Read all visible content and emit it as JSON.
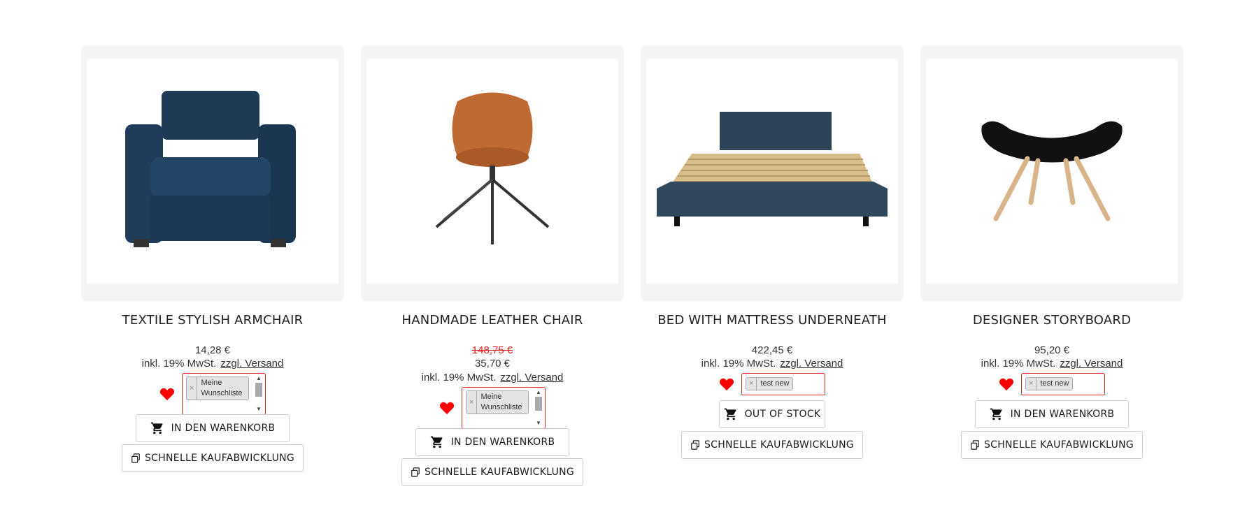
{
  "colors": {
    "accent_red": "#e32626",
    "heart": "#ff0000",
    "strike_price": "#e02020"
  },
  "products": [
    {
      "title": "TEXTILE STYLISH ARMCHAIR",
      "image": "blue-armchair-image",
      "old_price": null,
      "price": "14,28 €",
      "tax": "inkl. 19% MwSt.",
      "shipping": "zzgl. Versand",
      "wishlist_tag": "Meine Wunschliste",
      "cart_label": "IN DEN WARENKORB",
      "quick_label": "SCHNELLE KAUFABWICKLUNG"
    },
    {
      "title": "HANDMADE LEATHER CHAIR",
      "image": "leather-chair-image",
      "old_price": "148,75 €",
      "price": "35,70 €",
      "tax": "inkl. 19% MwSt.",
      "shipping": "zzgl. Versand",
      "wishlist_tag": "Meine Wunschliste",
      "cart_label": "IN DEN WARENKORB",
      "quick_label": "SCHNELLE KAUFABWICKLUNG"
    },
    {
      "title": "BED WITH MATTRESS UNDERNEATH",
      "image": "bed-image",
      "old_price": null,
      "price": "422,45 €",
      "tax": "inkl. 19% MwSt.",
      "shipping": "zzgl. Versand",
      "wishlist_tag": "test new",
      "cart_label": "OUT OF STOCK",
      "quick_label": "SCHNELLE KAUFABWICKLUNG"
    },
    {
      "title": "DESIGNER STORYBOARD",
      "image": "stool-image",
      "old_price": null,
      "price": "95,20 €",
      "tax": "inkl. 19% MwSt.",
      "shipping": "zzgl. Versand",
      "wishlist_tag": "test new",
      "cart_label": "IN DEN WARENKORB",
      "quick_label": "SCHNELLE KAUFABWICKLUNG"
    }
  ]
}
